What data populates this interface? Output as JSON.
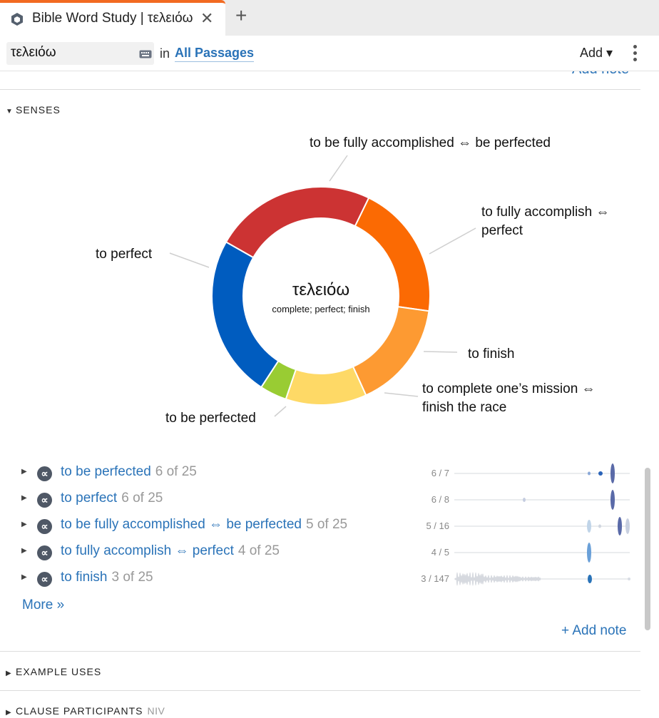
{
  "tab": {
    "title": "Bible Word Study | τελειόω",
    "close_glyph": "✕",
    "add_glyph": "+"
  },
  "toolbar": {
    "search_value": "τελειόω",
    "in_label": "in",
    "passages_label": "All Passages",
    "add_label": "Add ▾"
  },
  "prev_add_note": "Add note",
  "senses": {
    "heading": "SENSES",
    "center_word": "τελειόω",
    "center_gloss": "complete; perfect; finish",
    "colors": [
      "#fb6a03",
      "#fd9a32",
      "#fed966",
      "#99cc33",
      "#005cbf",
      "#cc3333"
    ],
    "rows": [
      {
        "label": "to be perfected",
        "count": "6 of 25",
        "ratio": "6 / 7"
      },
      {
        "label": "to perfect",
        "count": "6 of 25",
        "ratio": "6 / 8"
      },
      {
        "label": "to be fully accomplished ⇔ be perfected",
        "count": "5 of 25",
        "ratio": "5 / 16"
      },
      {
        "label": "to fully accomplish ⇔ perfect",
        "count": "4 of 25",
        "ratio": "4 / 5"
      },
      {
        "label": "to finish",
        "count": "3 of 25",
        "ratio": "3 / 147"
      }
    ],
    "more_label": "More »",
    "add_note_label": "+ Add note"
  },
  "chart_data": {
    "type": "pie",
    "title": "τελειόω",
    "subtitle": "complete; perfect; finish",
    "categories": [
      "to be fully accomplished ⇔ be perfected",
      "to fully accomplish ⇔ perfect",
      "to finish",
      "to complete one’s mission ⇔ finish the race",
      "to be perfected",
      "to perfect"
    ],
    "values": [
      5,
      4,
      3,
      1,
      6,
      6
    ],
    "label_lines": [
      [
        "to be fully accomplished ⇔ be perfected"
      ],
      [
        "to fully accomplish ⇔",
        "perfect"
      ],
      [
        "to finish"
      ],
      [
        "to complete one’s mission ⇔",
        "finish the race"
      ],
      [
        "to be perfected"
      ],
      [
        "to perfect"
      ]
    ]
  },
  "sections": {
    "example_uses": "EXAMPLE USES",
    "clause_participants": "CLAUSE PARTICIPANTS",
    "clause_sub": "NIV"
  }
}
